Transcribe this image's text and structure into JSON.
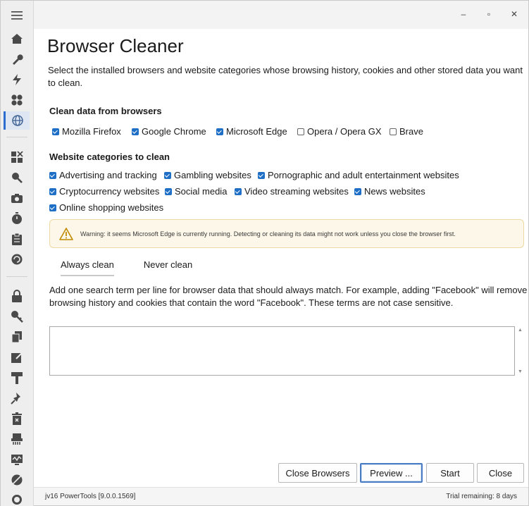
{
  "window": {
    "minimize": "–",
    "maximize": "▫",
    "close": "✕"
  },
  "sidebar": {
    "items": [
      {
        "name": "home-icon"
      },
      {
        "name": "wrench-icon"
      },
      {
        "name": "bolt-icon"
      },
      {
        "name": "apps-icon"
      },
      {
        "name": "globe-icon",
        "active": true
      },
      {
        "name": "grid-x-icon"
      },
      {
        "name": "search-icon"
      },
      {
        "name": "camera-icon"
      },
      {
        "name": "timer-icon"
      },
      {
        "name": "clipboard-icon"
      },
      {
        "name": "refresh-icon"
      },
      {
        "name": "lock-icon"
      },
      {
        "name": "key-icon"
      },
      {
        "name": "copy-icon"
      },
      {
        "name": "edit-icon"
      },
      {
        "name": "hammer-icon"
      },
      {
        "name": "pin-icon"
      },
      {
        "name": "trash-icon"
      },
      {
        "name": "shredder-icon"
      },
      {
        "name": "monitor-icon"
      },
      {
        "name": "globe-off-icon"
      },
      {
        "name": "power-icon"
      }
    ]
  },
  "page": {
    "title": "Browser Cleaner",
    "subtitle": "Select the installed browsers and website categories whose browsing history, cookies and other stored data you want to clean."
  },
  "browsers": {
    "heading": "Clean data from browsers",
    "items": [
      {
        "label": "Mozilla Firefox",
        "checked": true
      },
      {
        "label": "Google Chrome",
        "checked": true
      },
      {
        "label": "Microsoft Edge",
        "checked": true
      },
      {
        "label": "Opera / Opera GX",
        "checked": false
      },
      {
        "label": "Brave",
        "checked": false
      }
    ]
  },
  "categories": {
    "heading": "Website categories to clean",
    "items": [
      {
        "label": "Advertising and tracking",
        "checked": true
      },
      {
        "label": "Gambling websites",
        "checked": true
      },
      {
        "label": "Pornographic and adult entertainment websites",
        "checked": true
      },
      {
        "label": "Cryptocurrency websites",
        "checked": true
      },
      {
        "label": "Social media",
        "checked": true
      },
      {
        "label": "Video streaming websites",
        "checked": true
      },
      {
        "label": "News websites",
        "checked": true
      },
      {
        "label": "Online shopping websites",
        "checked": true
      }
    ]
  },
  "warning": {
    "text": "Warning: it seems Microsoft Edge is currently running. Detecting or cleaning its data might not work unless you close the browser first.",
    "color": "#f0b400"
  },
  "tabs": [
    {
      "label": "Always clean",
      "active": true
    },
    {
      "label": "Never clean",
      "active": false
    }
  ],
  "terms": {
    "description": "Add one search term per line for browser data that should always match. For example, adding \"Facebook\" will remove all browsing history and cookies that contain the word \"Facebook\". These terms are not case sensitive.",
    "value": ""
  },
  "buttons": {
    "close_browsers": "Close Browsers",
    "preview": "Preview ...",
    "start": "Start",
    "close": "Close"
  },
  "status": {
    "version": "jv16 PowerTools [9.0.0.1569]",
    "trial": "Trial remaining: 8 days"
  },
  "colors": {
    "accent": "#1f6fc6",
    "sidebar_icon": "#4a4a4a"
  }
}
